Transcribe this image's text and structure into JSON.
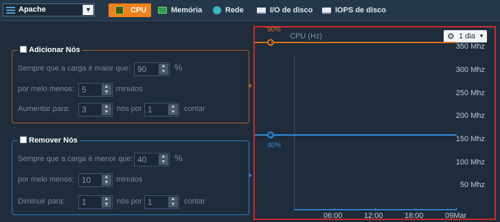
{
  "app_select": {
    "value": "Apache"
  },
  "tabs": [
    {
      "label": "CPU",
      "icon": "cpu-icon",
      "active": true
    },
    {
      "label": "Memória",
      "icon": "memory-icon"
    },
    {
      "label": "Rede",
      "icon": "network-icon"
    },
    {
      "label": "I/O de disco",
      "icon": "disk-icon"
    },
    {
      "label": "IOPS de disco",
      "icon": "disk-icon"
    }
  ],
  "add_nodes": {
    "title": "Adicionar Nós",
    "load_label": "Sempre que a carga é maior que:",
    "load_value": "90",
    "load_unit": "%",
    "duration_label": "por melo menos:",
    "duration_value": "5",
    "duration_unit": "minutos",
    "increase_label": "Aumentar para:",
    "increase_value": "3",
    "nodes_per_label": "nós por",
    "per_value": "1",
    "count_unit": "contar"
  },
  "remove_nodes": {
    "title": "Remover Nós",
    "load_label": "Sempre que a carga é menor que:",
    "load_value": "40",
    "load_unit": "%",
    "duration_label": "por melo menos:",
    "duration_value": "10",
    "duration_unit": "minutos",
    "decrease_label": "Diminuir para:",
    "decrease_value": "1",
    "nodes_per_label": "nós por",
    "per_value": "1",
    "count_unit": "contar"
  },
  "chart": {
    "title": "CPU (Hz)",
    "range_label": "1 dia",
    "upper_threshold_label": "90%",
    "lower_threshold_label": "40%"
  },
  "colors": {
    "accent": "#f0801a",
    "add_border": "#b46424",
    "remove_border": "#2e7fc0",
    "upper_line": "#d9741c",
    "lower_line": "#2e8fe0",
    "highlight_box": "#d12a2a"
  },
  "chart_data": {
    "type": "line",
    "title": "CPU (Hz)",
    "y_ticks": [
      "350 Mhz",
      "300 Mhz",
      "250 Mhz",
      "200 Mhz",
      "150 Mhz",
      "100 Mhz",
      "50 Mhz"
    ],
    "y_values": [
      350,
      300,
      250,
      200,
      150,
      100,
      50
    ],
    "ylim": [
      0,
      380
    ],
    "x_ticks": [
      "06:00",
      "12:00",
      "18:00",
      "09Mar"
    ],
    "x_positions_hours": [
      6,
      12,
      18,
      24
    ],
    "xlim_hours": [
      0,
      24
    ],
    "thresholds": [
      {
        "label": "90%",
        "value": 360,
        "color": "#d9741c"
      },
      {
        "label": "40%",
        "value": 160,
        "color": "#2e8fe0"
      }
    ],
    "series": [
      {
        "x": [
          0,
          24
        ],
        "values": [
          0,
          0
        ],
        "color": "#2a7fd0"
      }
    ]
  }
}
